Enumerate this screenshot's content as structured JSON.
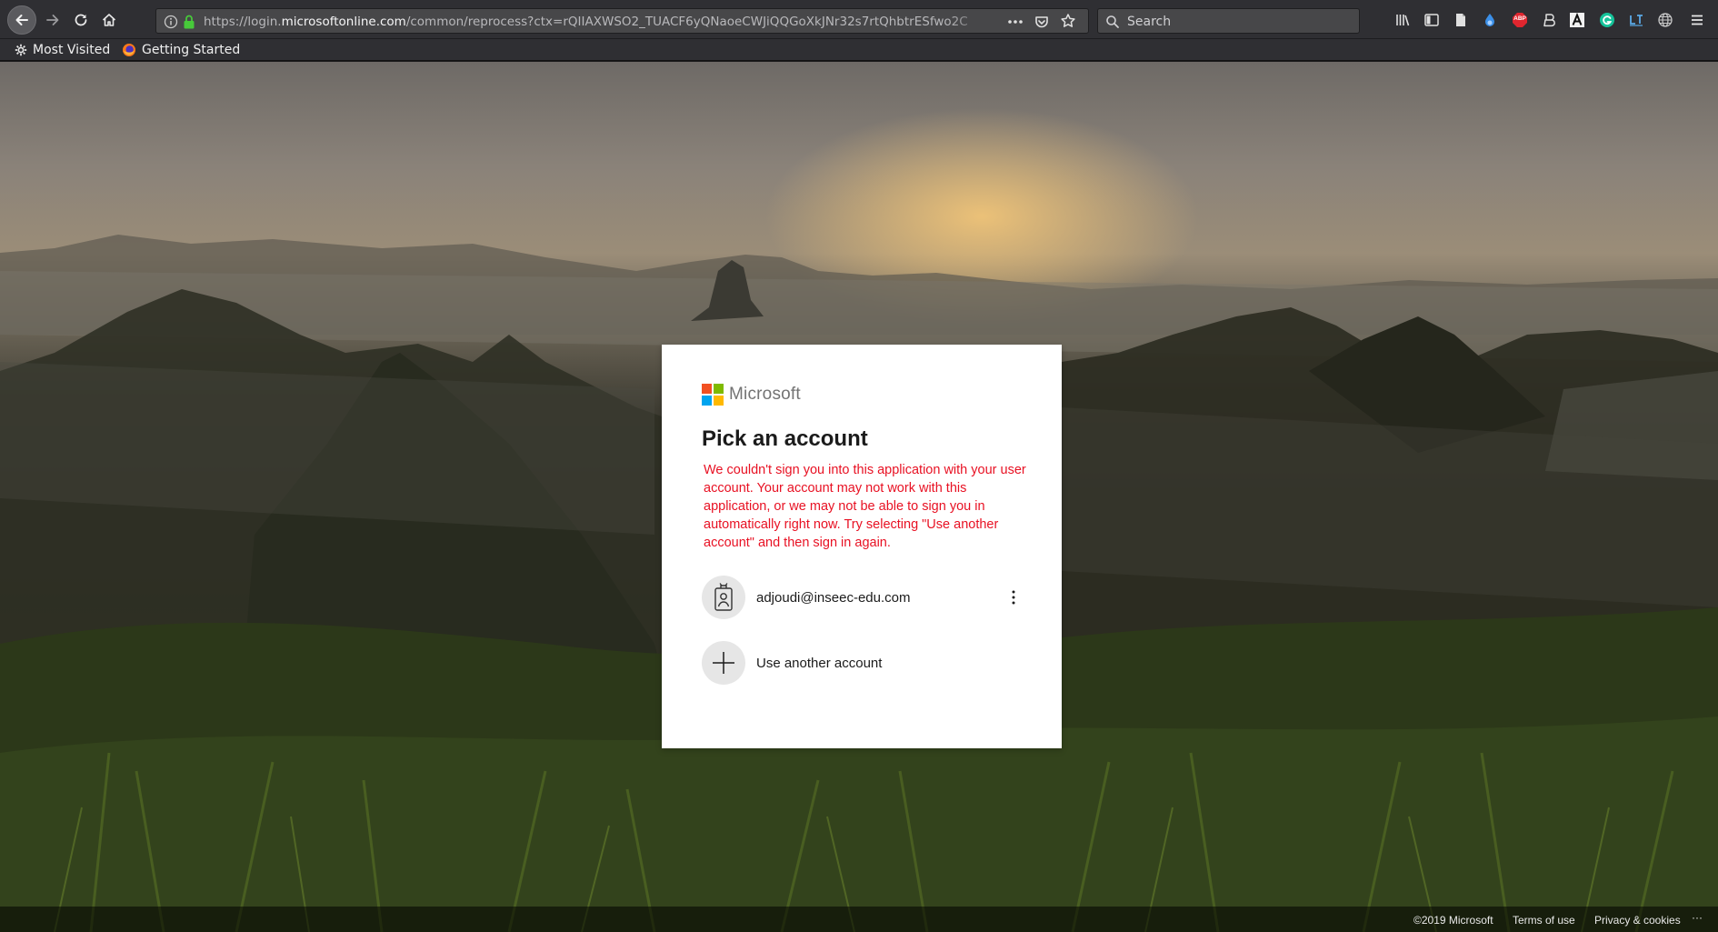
{
  "browser": {
    "url_prefix": "https://login.",
    "url_host": "microsoftonline.com",
    "url_path": "/common/reprocess?ctx=rQIIAXWSO2_TUACF6yQNaoeCWJiQQGoXkJNr32s7rtQhbtrESfwo2C",
    "search_placeholder": "Search",
    "bookmarks": [
      {
        "label": "Most Visited",
        "icon": "gear-icon"
      },
      {
        "label": "Getting Started",
        "icon": "firefox-icon"
      }
    ],
    "extension_icons": [
      "library-icon",
      "sidebar-icon",
      "reader-icon",
      "drop-icon",
      "adblock-icon",
      "b-icon",
      "a-icon",
      "grammarly-icon",
      "lt-icon",
      "globe-icon",
      "menu-icon"
    ],
    "adblock_label": "ABP"
  },
  "card": {
    "brand": "Microsoft",
    "title": "Pick an account",
    "error": "We couldn't sign you into this application with your user account. Your account may not work with this application, or we may not be able to sign you in automatically right now. Try selecting \"Use another account\" and then sign in again.",
    "accounts": [
      {
        "email": "adjoudi@inseec-edu.com"
      }
    ],
    "use_another": "Use another account",
    "logo_colors": [
      "#f25022",
      "#7fba00",
      "#00a4ef",
      "#ffb900"
    ]
  },
  "footer": {
    "copyright": "©2019 Microsoft",
    "terms": "Terms of use",
    "privacy": "Privacy & cookies",
    "more": "···"
  }
}
